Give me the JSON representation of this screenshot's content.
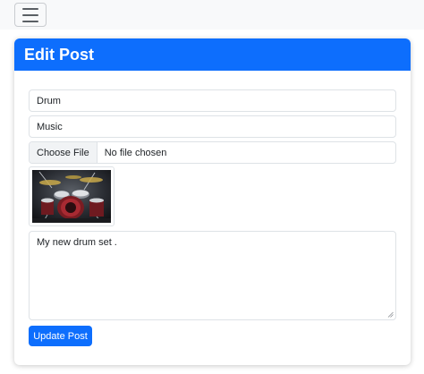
{
  "navbar": {
    "toggle_icon": "hamburger-menu-icon"
  },
  "card": {
    "title": "Edit Post"
  },
  "form": {
    "title_value": "Drum",
    "category_value": "Music",
    "file": {
      "button_label": "Choose File",
      "status": "No file chosen"
    },
    "image_description": "drum-kit-photo",
    "body_value": "My new drum set .",
    "submit_label": "Update Post"
  },
  "colors": {
    "primary": "#0d6efd",
    "navbar_bg": "#f8f9fa",
    "border": "#dee2e6"
  }
}
